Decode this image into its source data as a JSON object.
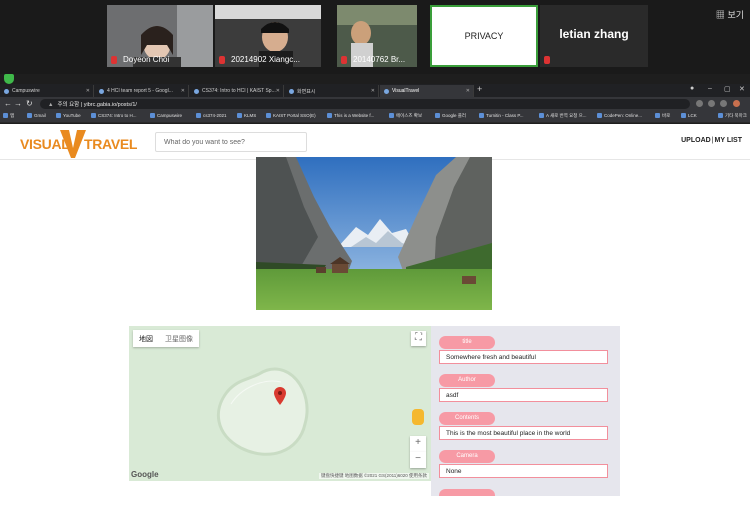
{
  "zoom": {
    "participants": [
      {
        "name": "Doyeon Choi"
      },
      {
        "name": "20214902 Xiangc..."
      },
      {
        "name": "20140762 Br..."
      },
      {
        "name": "PRIVACY"
      },
      {
        "name": "letian zhang"
      }
    ],
    "view_label": "보기"
  },
  "browser": {
    "tabs": [
      {
        "label": "Campuswire"
      },
      {
        "label": "4 HCI team report 5 - Googl..."
      },
      {
        "label": "CS374: Intro to HCI | KAIST Sp..."
      },
      {
        "label": "화면표시"
      },
      {
        "label": "VisualTravel"
      }
    ],
    "new_tab": "+",
    "address": {
      "security": "주의 요함",
      "url": "yibrc.gabia.io/posts/1/"
    },
    "bookmarks": [
      "앱",
      "Gmail",
      "YouTube",
      "CS374: Intro to H...",
      "Campuswire",
      "cs374-2021",
      "KLMS",
      "KAIST Portal SSO(E)",
      "This is a Website f...",
      "에이스즈 확보",
      "Google 플러",
      "Turnitin - Class P...",
      "A 새로 번역 요청 으...",
      "CodePen: Online...",
      "바로",
      "LCK",
      "기타 북마크"
    ]
  },
  "site": {
    "logo": {
      "left": "VISUAL",
      "mark": "V",
      "right": "TRAVEL"
    },
    "search_placeholder": "What do you want to see?",
    "upload_label": "UPLOAD",
    "separator": "|",
    "mylist_label": "MY LIST",
    "photo_alt": "Valley with tall cliffs, snowy mountains, green meadow and small cabins",
    "map": {
      "type_map": "地図",
      "type_satellite": "卫星图像",
      "zoom_in": "+",
      "zoom_out": "−",
      "fullscreen": "⛶",
      "logo": "Google",
      "attribution": "键盘快捷键  地图数据 ©2021 GS(2011)6020  使用条款"
    },
    "form": {
      "fields": [
        {
          "label": "title",
          "value": "Somewhere fresh and beautiful"
        },
        {
          "label": "Author",
          "value": "asdf"
        },
        {
          "label": "Contents",
          "value": "This is the most beautiful place in the world"
        },
        {
          "label": "Camera",
          "value": "None"
        }
      ]
    }
  },
  "colors": {
    "accent_orange": "#e98a1f",
    "pill_pink": "#f79aa5",
    "field_border": "#f28f9c",
    "map_green": "#d9ead6",
    "marker_red": "#d93a2f"
  }
}
